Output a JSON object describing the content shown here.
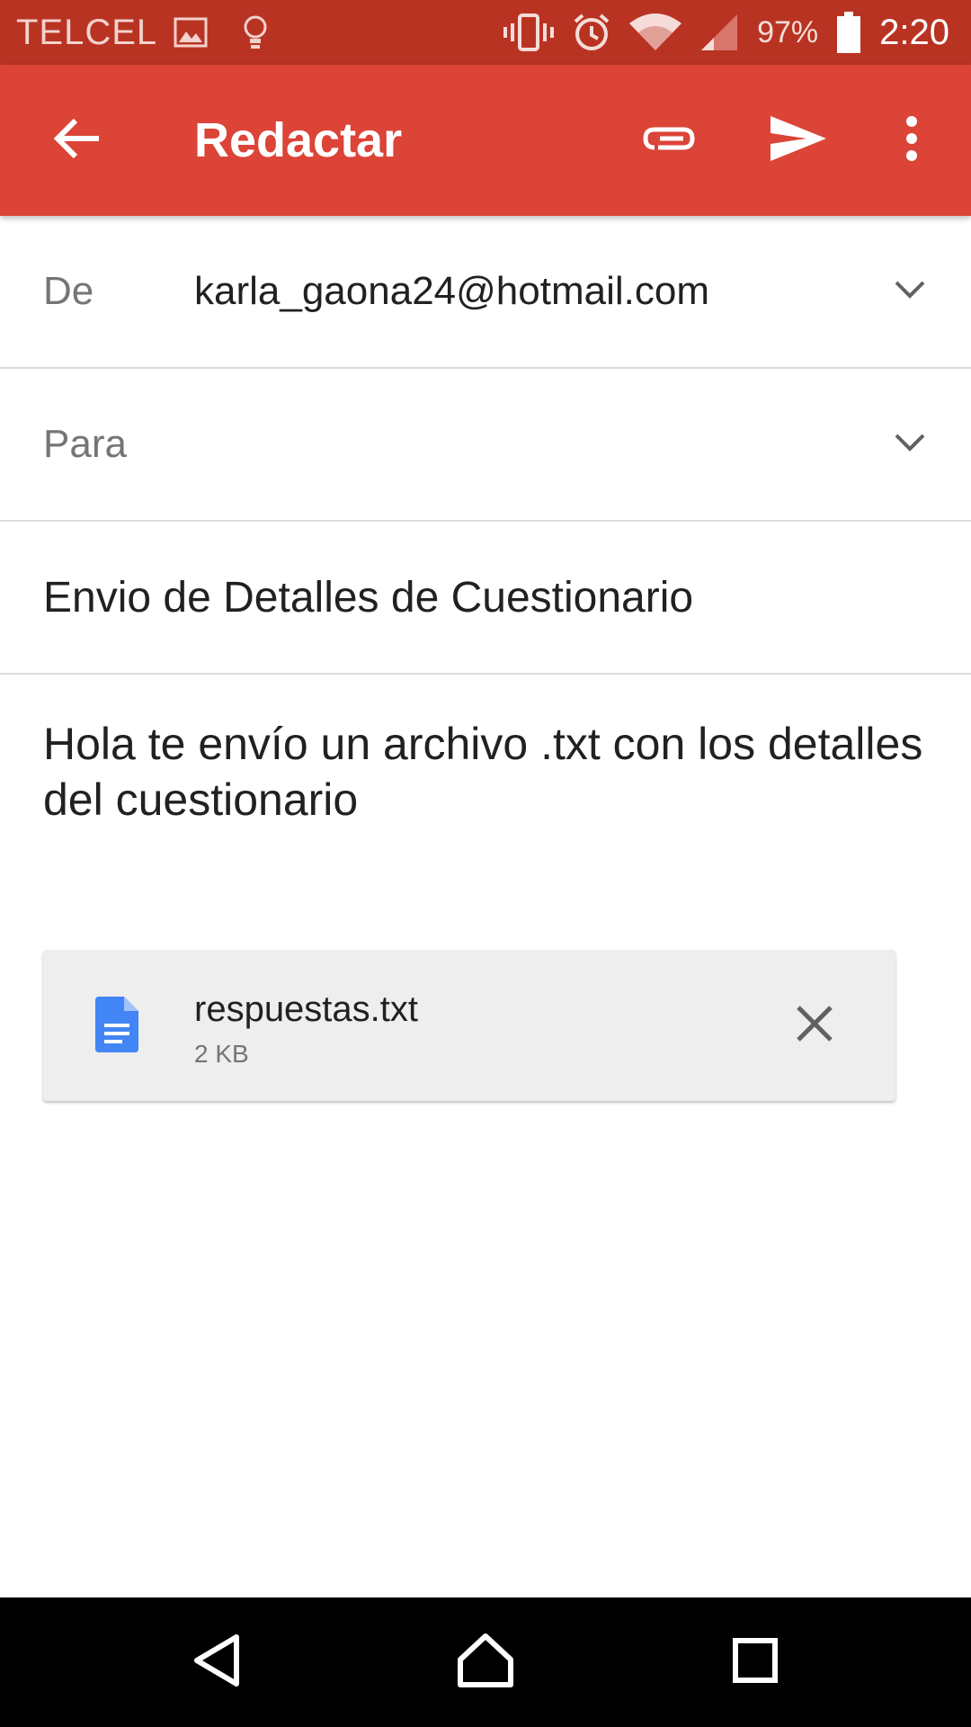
{
  "status_bar": {
    "carrier": "TELCEL",
    "battery": "97%",
    "time": "2:20",
    "left_icons": [
      "image-icon",
      "lightbulb-icon"
    ],
    "right_icons": [
      "vibrate-icon",
      "alarm-icon",
      "wifi-icon",
      "signal-icon",
      "battery-icon"
    ]
  },
  "app_bar": {
    "title": "Redactar",
    "background_color": "#db4437",
    "status_color": "#b93323"
  },
  "compose": {
    "from_label": "De",
    "from_value": "karla_gaona24@hotmail.com",
    "to_label": "Para",
    "to_value": "",
    "subject": "Envio de Detalles de Cuestionario",
    "body": "Hola te envío un archivo .txt con los detalles del cuestionario"
  },
  "attachment": {
    "name": "respuestas.txt",
    "size": "2 KB",
    "icon": "document-icon",
    "icon_color": "#4285f4"
  },
  "nav_bar": {
    "buttons": [
      "back-icon",
      "home-icon",
      "recents-icon"
    ]
  }
}
